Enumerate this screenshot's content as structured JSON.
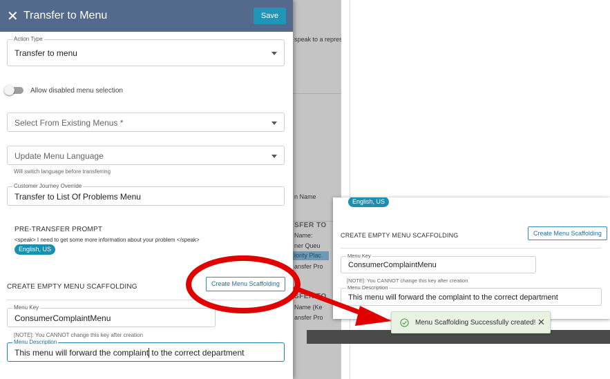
{
  "background": {
    "fragments": [
      "speak to a repres",
      "SFER TO",
      "Name:",
      "ner Queu",
      "iority Plac",
      "ansfer Pro",
      "SFER TO",
      "Name (Ke",
      "ansfer Pro",
      "n Name"
    ]
  },
  "drawer": {
    "title": "Transfer to Menu",
    "save_label": "Save",
    "action_type": {
      "label": "Action Type",
      "value": "Transfer to menu"
    },
    "toggle_label": "Allow disabled menu selection",
    "existing_menus_placeholder": "Select From Existing Menus *",
    "menu_language_placeholder": "Update Menu Language",
    "menu_language_helper": "Will switch language before transferring",
    "journey_override": {
      "label": "Customer Journey Override",
      "value": "Transfer to List Of Problems Menu"
    },
    "pre_transfer": {
      "title": "PRE-TRANSFER PROMPT",
      "text": "<speak> I need to get some more information about your problem </speak>",
      "language_chip": "English, US"
    },
    "scaffolding": {
      "title": "CREATE EMPTY MENU SCAFFOLDING",
      "button_label": "Create Menu Scaffolding",
      "menu_key_label": "Menu Key",
      "menu_key_value": "ConsumerComplaintMenu",
      "note": "[NOTE]: You CANNOT change this key after creation",
      "description_label": "Menu Description",
      "description_value_a": "This menu will forward the complaint",
      "description_value_b": " to the correct department"
    }
  },
  "right_panel": {
    "language_chip": "English, US",
    "title": "CREATE EMPTY MENU SCAFFOLDING",
    "button_label": "Create Menu Scaffolding",
    "menu_key_label": "Menu Key",
    "menu_key_value": "ConsumerComplaintMenu",
    "note": "[NOTE]: You CANNOT change this key after creation",
    "description_label": "Menu Description",
    "description_value": "This menu will forward the complaint to the correct department"
  },
  "toast": {
    "message": "Menu Scaffolding Successfully created!"
  },
  "colors": {
    "header": "#536a8c",
    "accent": "#1f96b8",
    "chip": "#1a8fb0",
    "annotation": "#e00000",
    "toast_bg": "#e8f3e4",
    "success": "#5aa05a"
  }
}
